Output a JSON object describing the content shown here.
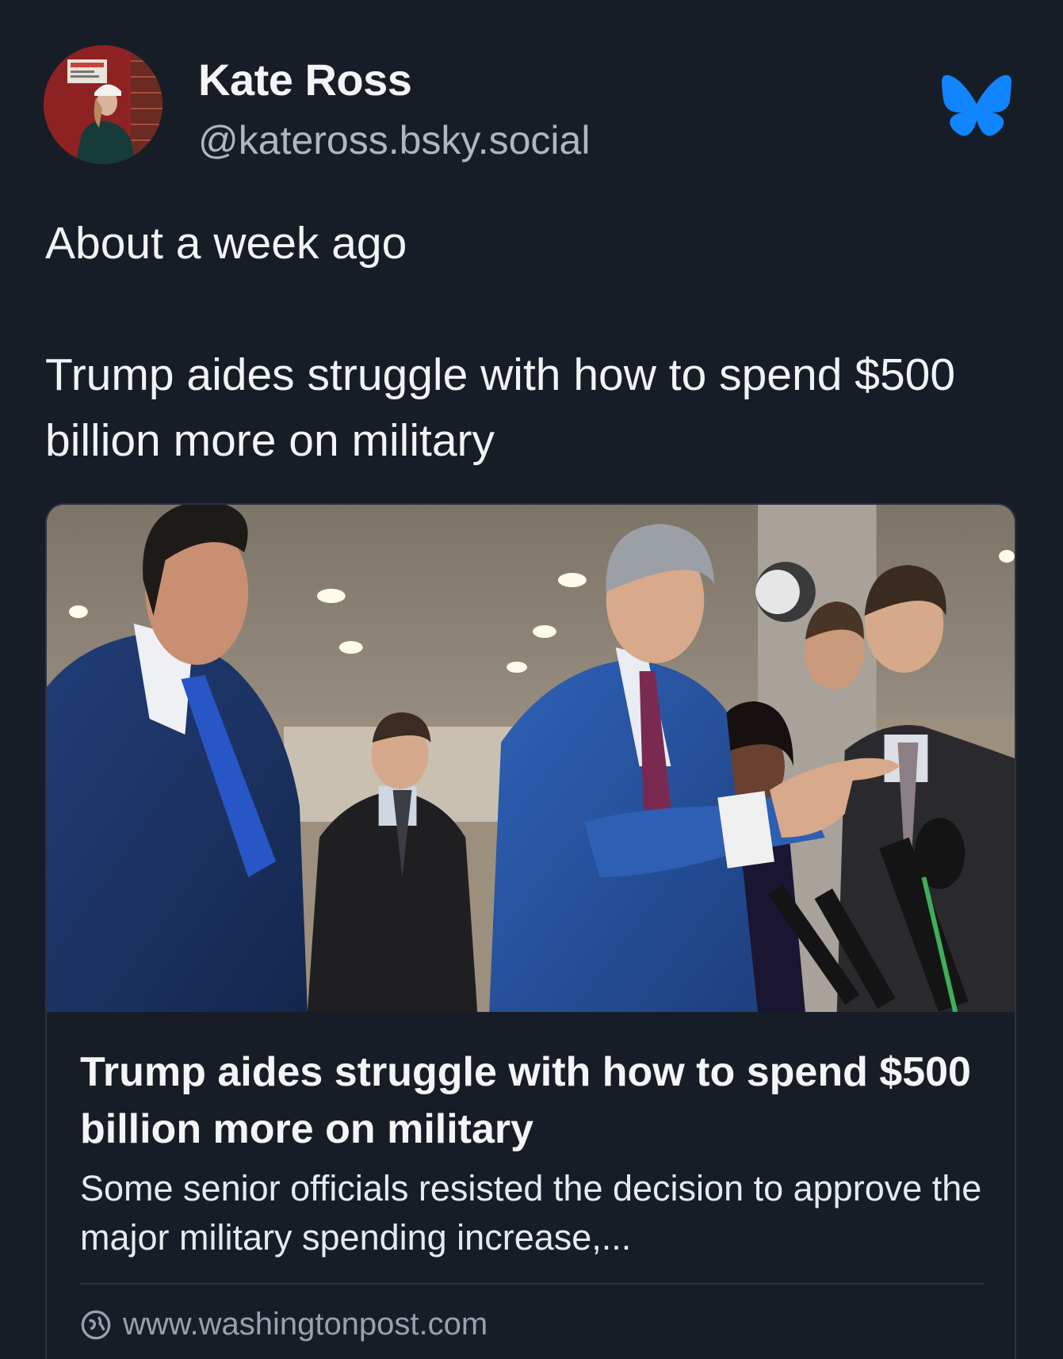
{
  "author": {
    "display_name": "Kate Ross",
    "handle": "@kateross.bsky.social"
  },
  "brand": {
    "logo_icon": "bluesky-butterfly-icon",
    "color": "#1185fe"
  },
  "post": {
    "line1": "About a week ago",
    "line2": "Trump aides struggle with how to spend $500 billion more on military"
  },
  "link_card": {
    "image_icon": "press-conference-photo",
    "title": "Trump aides struggle with how to spend $500 billion more on military",
    "description": "Some senior officials resisted the decision to approve the major military spending increase,...",
    "domain_icon": "globe-icon",
    "domain": "www.washingtonpost.com"
  },
  "theme": {
    "background": "#171d27",
    "text": "#f1f3f5",
    "muted": "#aeb6c2",
    "border": "#2c3340"
  }
}
